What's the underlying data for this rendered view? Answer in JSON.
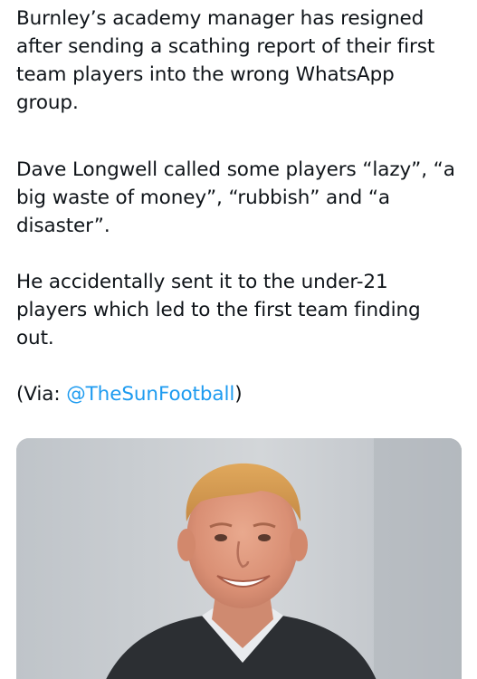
{
  "tweet": {
    "paragraphs": [
      "Burnley’s academy manager has resigned after sending a scathing report of their first team players into the wrong WhatsApp group.",
      "Dave Longwell called some players “lazy”, “a big waste of money”, “rubbish” and “a disaster”.",
      "He accidentally sent it to the under-21 players which led to the first team finding out."
    ],
    "via_prefix": "(Via: ",
    "via_mention": "@TheSunFootball",
    "via_suffix": ")"
  },
  "media": {
    "type": "photo",
    "subject": "portrait-of-man"
  }
}
